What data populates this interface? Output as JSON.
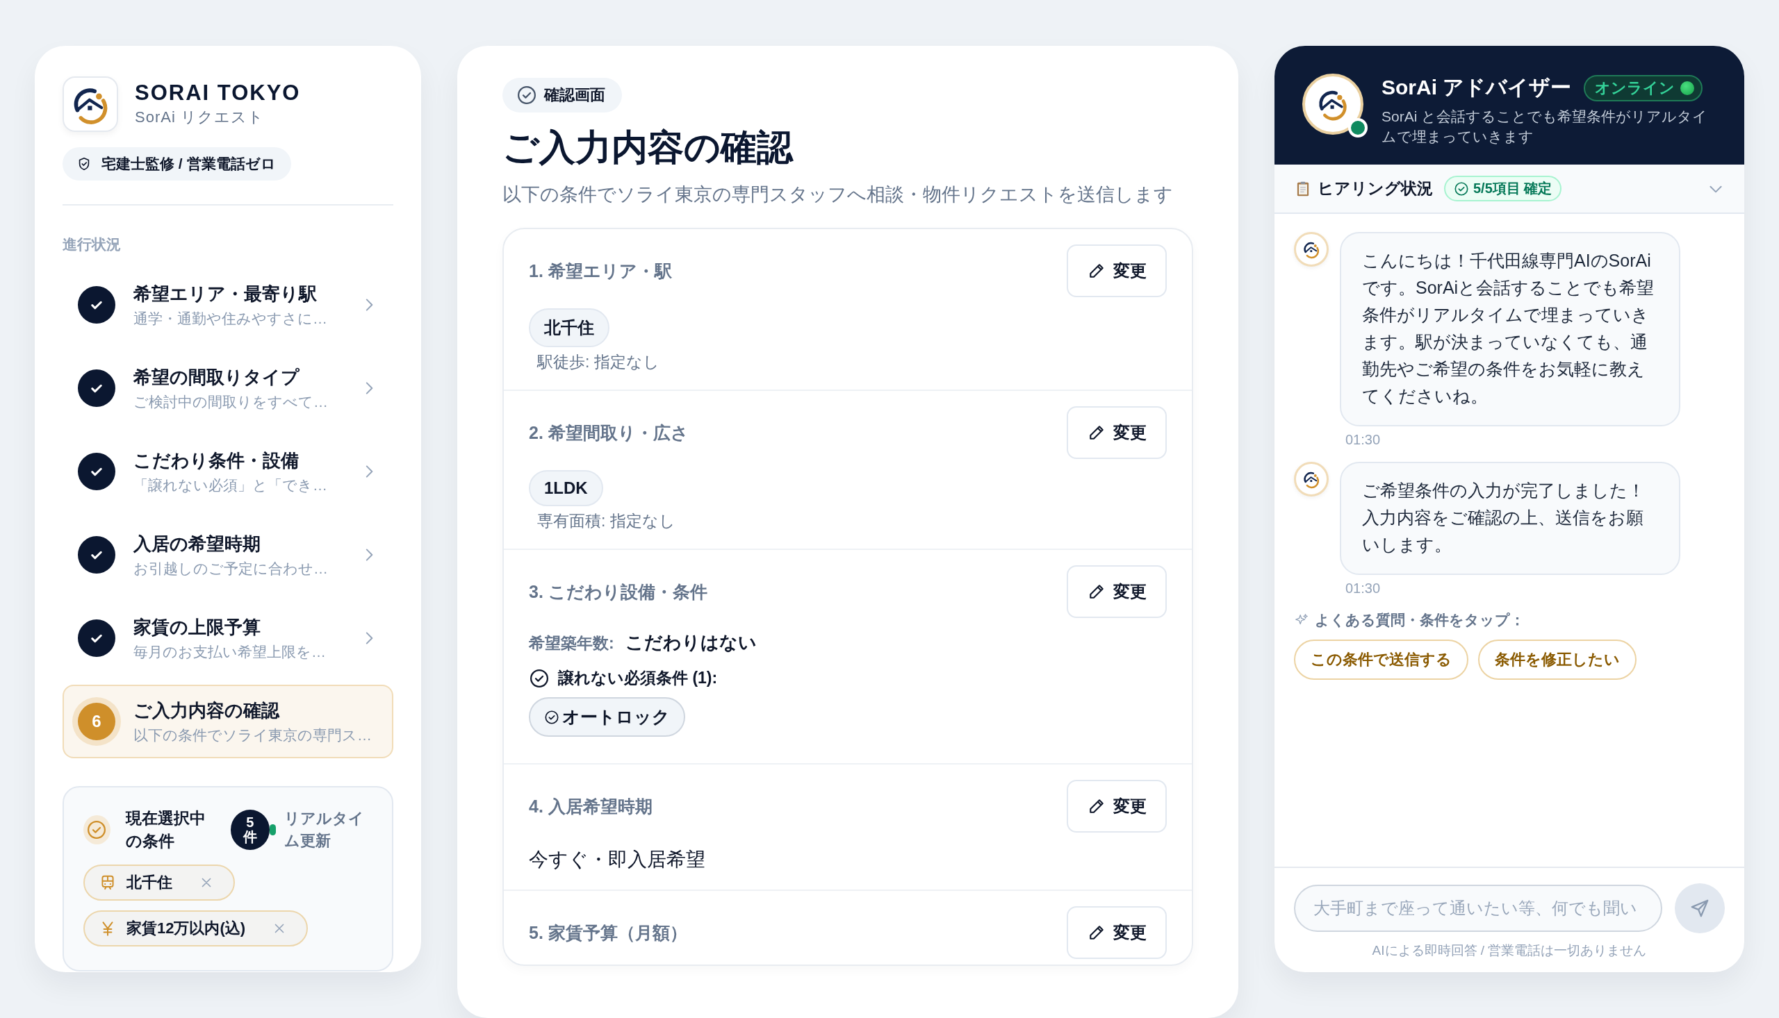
{
  "brand": {
    "name": "SORAI TOKYO",
    "subtitle": "SorAi リクエスト",
    "badge": "宅建士監修 / 営業電話ゼロ"
  },
  "progress": {
    "label": "進行状況",
    "steps": [
      {
        "kind": "done",
        "title": "希望エリア・最寄り駅",
        "description": "通学・通勤や住みやすさに…",
        "selected": false
      },
      {
        "kind": "done",
        "title": "希望の間取りタイプ",
        "description": "ご検討中の間取りをすべて…",
        "selected": false
      },
      {
        "kind": "done",
        "title": "こだわり条件・設備",
        "description": "「譲れない必須」と「でき…",
        "selected": false
      },
      {
        "kind": "done",
        "title": "入居の希望時期",
        "description": "お引越しのご予定に合わせ…",
        "selected": false
      },
      {
        "kind": "done",
        "title": "家賃の上限予算",
        "description": "毎月のお支払い希望上限を…",
        "selected": false
      },
      {
        "kind": "current",
        "title": "ご入力内容の確認",
        "description": "以下の条件でソライ東京の専門ス…",
        "number": "6",
        "selected": true
      }
    ]
  },
  "current_conditions": {
    "title": "現在選択中の条件",
    "count": "5件",
    "live_label": "リアルタイム更新",
    "chips": [
      {
        "kind": "station",
        "label": "北千住"
      },
      {
        "kind": "rent",
        "label": "家賃12万以内(込)"
      }
    ]
  },
  "confirmation": {
    "badge": "確認画面",
    "title": "ご入力内容の確認",
    "description": "以下の条件でソライ東京の専門スタッフへ相談・物件リクエストを送信します",
    "sections": [
      {
        "kind": "tag",
        "title": "1. 希望エリア・駅",
        "edit": "変更",
        "tag": "北千住",
        "note": "駅徒歩: 指定なし"
      },
      {
        "kind": "tag",
        "title": "2. 希望間取り・広さ",
        "edit": "変更",
        "tag": "1LDK",
        "note": "専有面積: 指定なし"
      },
      {
        "kind": "features",
        "title": "3. こだわり設備・条件",
        "edit": "変更",
        "age_label": "希望築年数:",
        "age_value": "こだわりはない",
        "must_label": "譲れない必須条件 (1):",
        "must_items": [
          "オートロック"
        ]
      },
      {
        "kind": "text",
        "title": "4. 入居希望時期",
        "edit": "変更",
        "text": "今すぐ・即入居希望"
      },
      {
        "kind": "empty",
        "title": "5. 家賃予算（月額）",
        "edit": "変更"
      }
    ]
  },
  "chat": {
    "title": "SorAi アドバイザー",
    "status": "オンライン",
    "online": true,
    "subtitle": "SorAi と会話することでも希望条件がリアルタイムで埋まっていきます",
    "hearing": {
      "label": "ヒアリング状況",
      "badge": "5/5項目 確定",
      "expanded": false
    },
    "messages": [
      {
        "text": "こんにちは！千代田線専門AIのSorAiです。SorAiと会話することでも希望条件がリアルタイムで埋まっていきます。駅が決まっていなくても、通勤先やご希望の条件をお気軽に教えてくださいね。",
        "time": "01:30"
      },
      {
        "text": "ご希望条件の入力が完了しました！入力内容をご確認の上、送信をお願いします。",
        "time": "01:30"
      }
    ],
    "suggestions_label": "よくある質問・条件をタップ：",
    "suggestions": [
      "この条件で送信する",
      "条件を修正したい"
    ],
    "input": {
      "placeholder": "大手町まで座って通いたい等、何でも聞い"
    },
    "footer": "AIによる即時回答 / 営業電話は一切ありません"
  }
}
